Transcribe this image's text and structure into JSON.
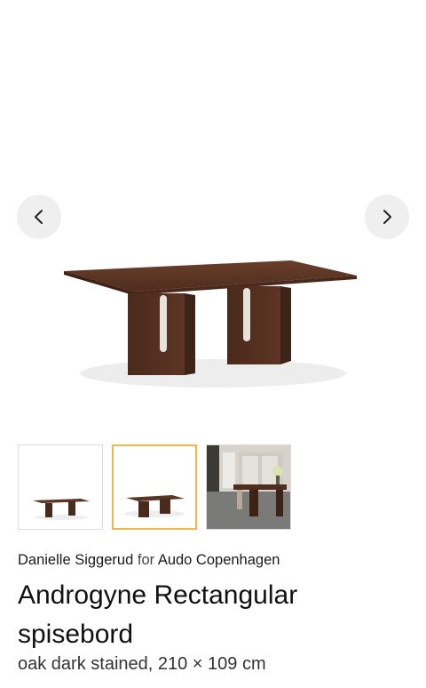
{
  "gallery": {
    "prev_icon": "chevron-left-icon",
    "next_icon": "chevron-right-icon",
    "thumbnails": [
      {
        "name": "thumbnail-1",
        "selected": false
      },
      {
        "name": "thumbnail-2",
        "selected": true
      },
      {
        "name": "thumbnail-3",
        "selected": false
      }
    ],
    "selected_border_color": "#f0b54c"
  },
  "product": {
    "designer": "Danielle Siggerud",
    "for_label": "for",
    "brand": "Audo Copenhagen",
    "title": "Androgyne Rectangular spisebord",
    "variant": "oak dark stained, 210 × 109 cm"
  },
  "colors": {
    "wood": "#5a3424",
    "nav_button_bg": "#efefef"
  }
}
